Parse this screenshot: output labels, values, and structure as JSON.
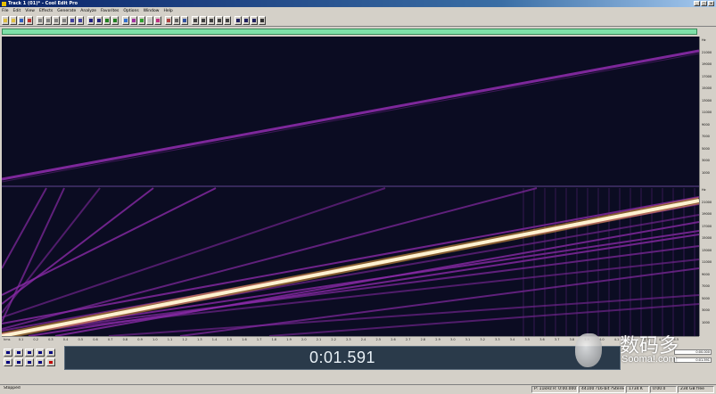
{
  "window": {
    "title": "Track 1 (01)* - Cool Edit Pro"
  },
  "menu": [
    "File",
    "Edit",
    "View",
    "Effects",
    "Generate",
    "Analyze",
    "Favorites",
    "Options",
    "Window",
    "Help"
  ],
  "toolbar_icons": [
    "new-icon",
    "open-icon",
    "save-icon",
    "close-icon",
    "cut-icon",
    "copy-icon",
    "paste-icon",
    "mix-paste-icon",
    "undo-icon",
    "redo-icon",
    "select-icon",
    "zoom-icon",
    "scrub-icon",
    "hybrid-icon",
    "waveform-icon",
    "spectral-icon",
    "multitrack-icon",
    "cd-icon",
    "loop-icon",
    "metronome-icon",
    "settings-icon",
    "info-icon",
    "effect1-icon",
    "effect2-icon",
    "effect3-icon",
    "effect4-icon",
    "effect5-icon",
    "analyze1-icon",
    "analyze2-icon",
    "analyze3-icon",
    "help-icon"
  ],
  "colors": {
    "spectral_bg": "#0b0c22",
    "harmonic": "#8a2aa8",
    "fundamental": "#fff2d0",
    "overview": "#7ee0a8"
  },
  "freq_ruler": [
    "Hz",
    "21000",
    "19000",
    "17000",
    "15000",
    "13000",
    "11000",
    "9000",
    "7000",
    "5000",
    "3000",
    "1000",
    "Hz",
    "21000",
    "19000",
    "17000",
    "15000",
    "13000",
    "11000",
    "9000",
    "7000",
    "5000",
    "3000",
    "1000"
  ],
  "time_ruler": [
    "hms",
    "0.1",
    "0.2",
    "0.3",
    "0.4",
    "0.5",
    "0.6",
    "0.7",
    "0.8",
    "0.9",
    "1.0",
    "1.1",
    "1.2",
    "1.3",
    "1.4",
    "1.5",
    "1.6",
    "1.7",
    "1.8",
    "1.9",
    "2.0",
    "2.1",
    "2.2",
    "2.3",
    "2.4",
    "2.5",
    "2.6",
    "2.7",
    "2.8",
    "2.9",
    "3.0",
    "3.1",
    "3.2",
    "3.3",
    "3.4",
    "3.5",
    "3.6",
    "3.7",
    "3.8",
    "3.9",
    "4.0",
    "4.1",
    "4.2",
    "4.3",
    "4.4",
    "4.5"
  ],
  "transport": {
    "buttons": [
      "stop",
      "play",
      "pause",
      "play-loop",
      "play-to-end",
      "go-start",
      "rewind",
      "fast-forward",
      "go-end",
      "record"
    ]
  },
  "time_display": "0:01.591",
  "zoom_panel": {
    "field1": "0:00.000",
    "field2": "0:01.591"
  },
  "status": {
    "left": "Stopped",
    "cells": [
      "P: 11kHz  R: 0:00.000",
      "44100 ?16-bit ?Stereo",
      "1734 K",
      "0:00.0",
      "234 GB free"
    ]
  },
  "watermark": {
    "cn": "数码多",
    "en": "Sooma!.com"
  }
}
